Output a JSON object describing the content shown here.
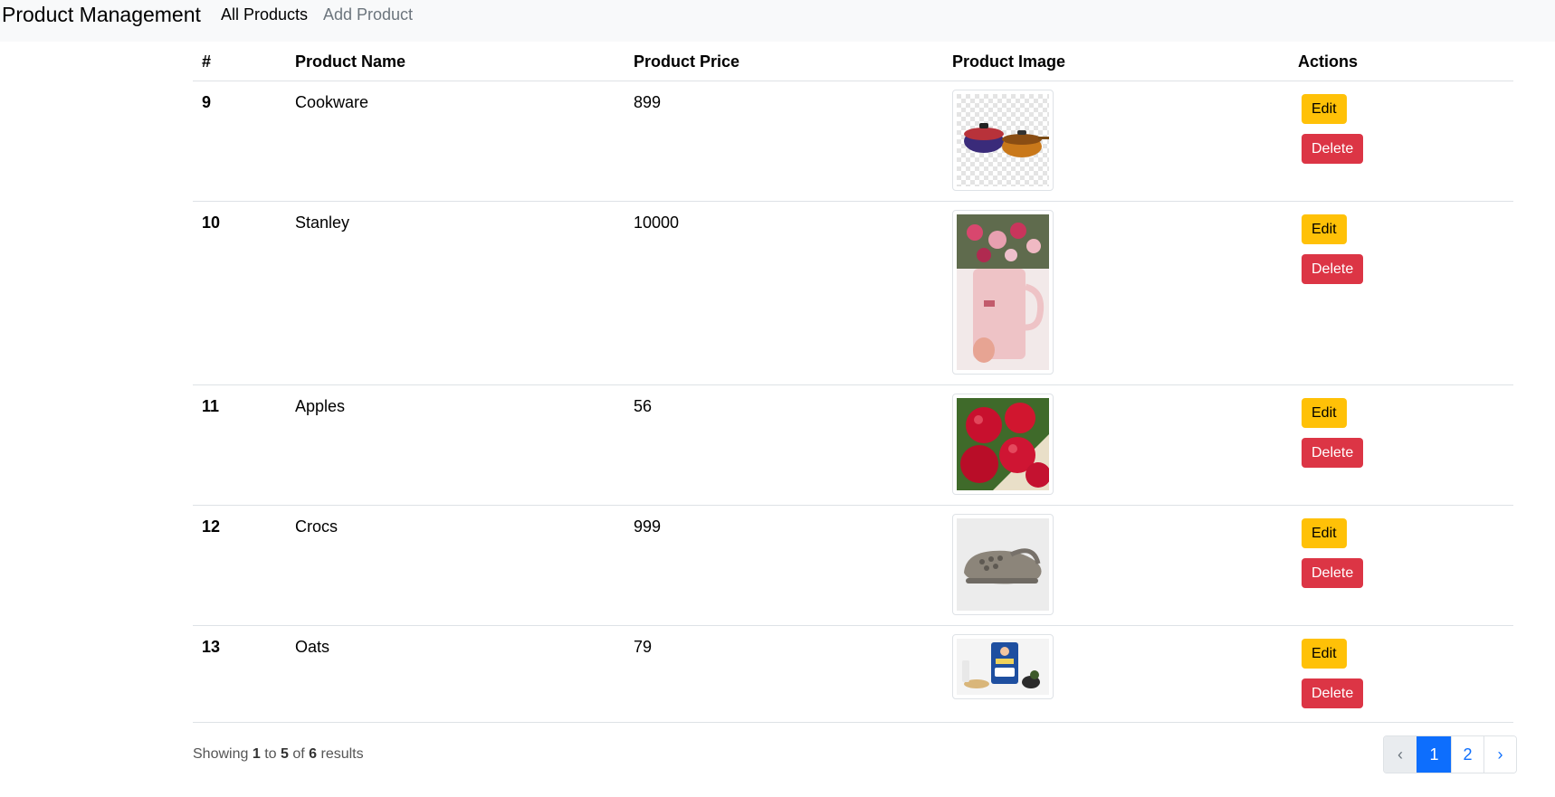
{
  "navbar": {
    "brand": "Product Management",
    "links": [
      {
        "label": "All Products",
        "active": true
      },
      {
        "label": "Add Product",
        "active": false
      }
    ]
  },
  "table": {
    "headers": [
      "#",
      "Product Name",
      "Product Price",
      "Product Image",
      "Actions"
    ],
    "rows": [
      {
        "id": "9",
        "name": "Cookware",
        "price": "899",
        "image": "cookware-pots-image"
      },
      {
        "id": "10",
        "name": "Stanley",
        "price": "10000",
        "image": "stanley-tumbler-flowers-image"
      },
      {
        "id": "11",
        "name": "Apples",
        "price": "56",
        "image": "red-apples-image"
      },
      {
        "id": "12",
        "name": "Crocs",
        "price": "999",
        "image": "grey-crocs-clog-image"
      },
      {
        "id": "13",
        "name": "Oats",
        "price": "79",
        "image": "oats-pack-image"
      }
    ],
    "edit_label": "Edit",
    "delete_label": "Delete"
  },
  "footer": {
    "showing": "Showing",
    "from": "1",
    "to_word": "to",
    "to": "5",
    "of_word": "of",
    "total": "6",
    "results": "results"
  },
  "pagination": {
    "prev": "‹",
    "pages": [
      "1",
      "2"
    ],
    "current": "1",
    "next": "›"
  },
  "colors": {
    "edit": "#ffc107",
    "delete": "#dc3545",
    "primary": "#0d6efd"
  }
}
